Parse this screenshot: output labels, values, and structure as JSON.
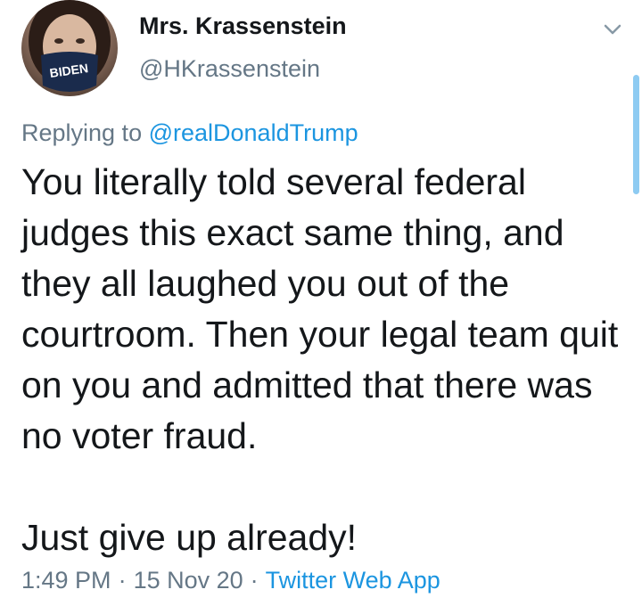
{
  "author": {
    "display_name": "Mrs. Krassenstein",
    "handle": "@HKrassenstein",
    "avatar_mask_text": "BIDEN"
  },
  "reply": {
    "prefix": "Replying to ",
    "mention": "@realDonaldTrump"
  },
  "tweet": {
    "text": "You literally told several federal judges this exact same thing, and they all laughed you out of the courtroom.  Then your legal team quit on you and admitted that there was no voter fraud.\n\nJust give up already!"
  },
  "meta": {
    "time": "1:49 PM",
    "separator": "·",
    "date": "15 Nov 20",
    "source": "Twitter Web App"
  },
  "icons": {
    "menu": "chevron-down-icon"
  },
  "colors": {
    "link": "#1b95e0",
    "secondary_text": "#657786",
    "primary_text": "#14171a",
    "scrollbar": "#8ecbf2"
  }
}
